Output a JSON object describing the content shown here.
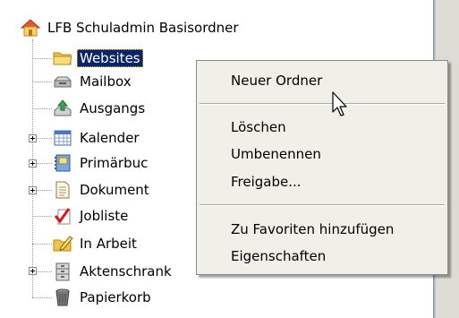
{
  "tree": {
    "root": {
      "label": "LFB Schuladmin Basisordner",
      "icon": "home-folder-icon"
    },
    "items": [
      {
        "label": "Websites",
        "icon": "folder-icon",
        "expandable": false,
        "selected": true
      },
      {
        "label": "Mailbox",
        "icon": "mailbox-icon",
        "expandable": false
      },
      {
        "label": "Ausgangs",
        "icon": "outbox-icon",
        "expandable": false
      },
      {
        "label": "Kalender",
        "icon": "calendar-icon",
        "expandable": true
      },
      {
        "label": "Primärbuc",
        "icon": "address-book-icon",
        "expandable": true
      },
      {
        "label": "Dokument",
        "icon": "documents-icon",
        "expandable": true
      },
      {
        "label": "Jobliste",
        "icon": "checkmark-list-icon",
        "expandable": false
      },
      {
        "label": "In Arbeit",
        "icon": "edit-folder-icon",
        "expandable": false
      },
      {
        "label": "Aktenschrank",
        "icon": "filing-cabinet-icon",
        "expandable": true
      },
      {
        "label": "Papierkorb",
        "icon": "trash-bin-icon",
        "expandable": false
      }
    ]
  },
  "context_menu": {
    "items": [
      {
        "label": "Neuer Ordner"
      },
      {
        "label": "Löschen"
      },
      {
        "label": "Umbenennen"
      },
      {
        "label": "Freigabe..."
      },
      {
        "label": "Zu Favoriten hinzufügen"
      },
      {
        "label": "Eigenschaften"
      }
    ]
  }
}
